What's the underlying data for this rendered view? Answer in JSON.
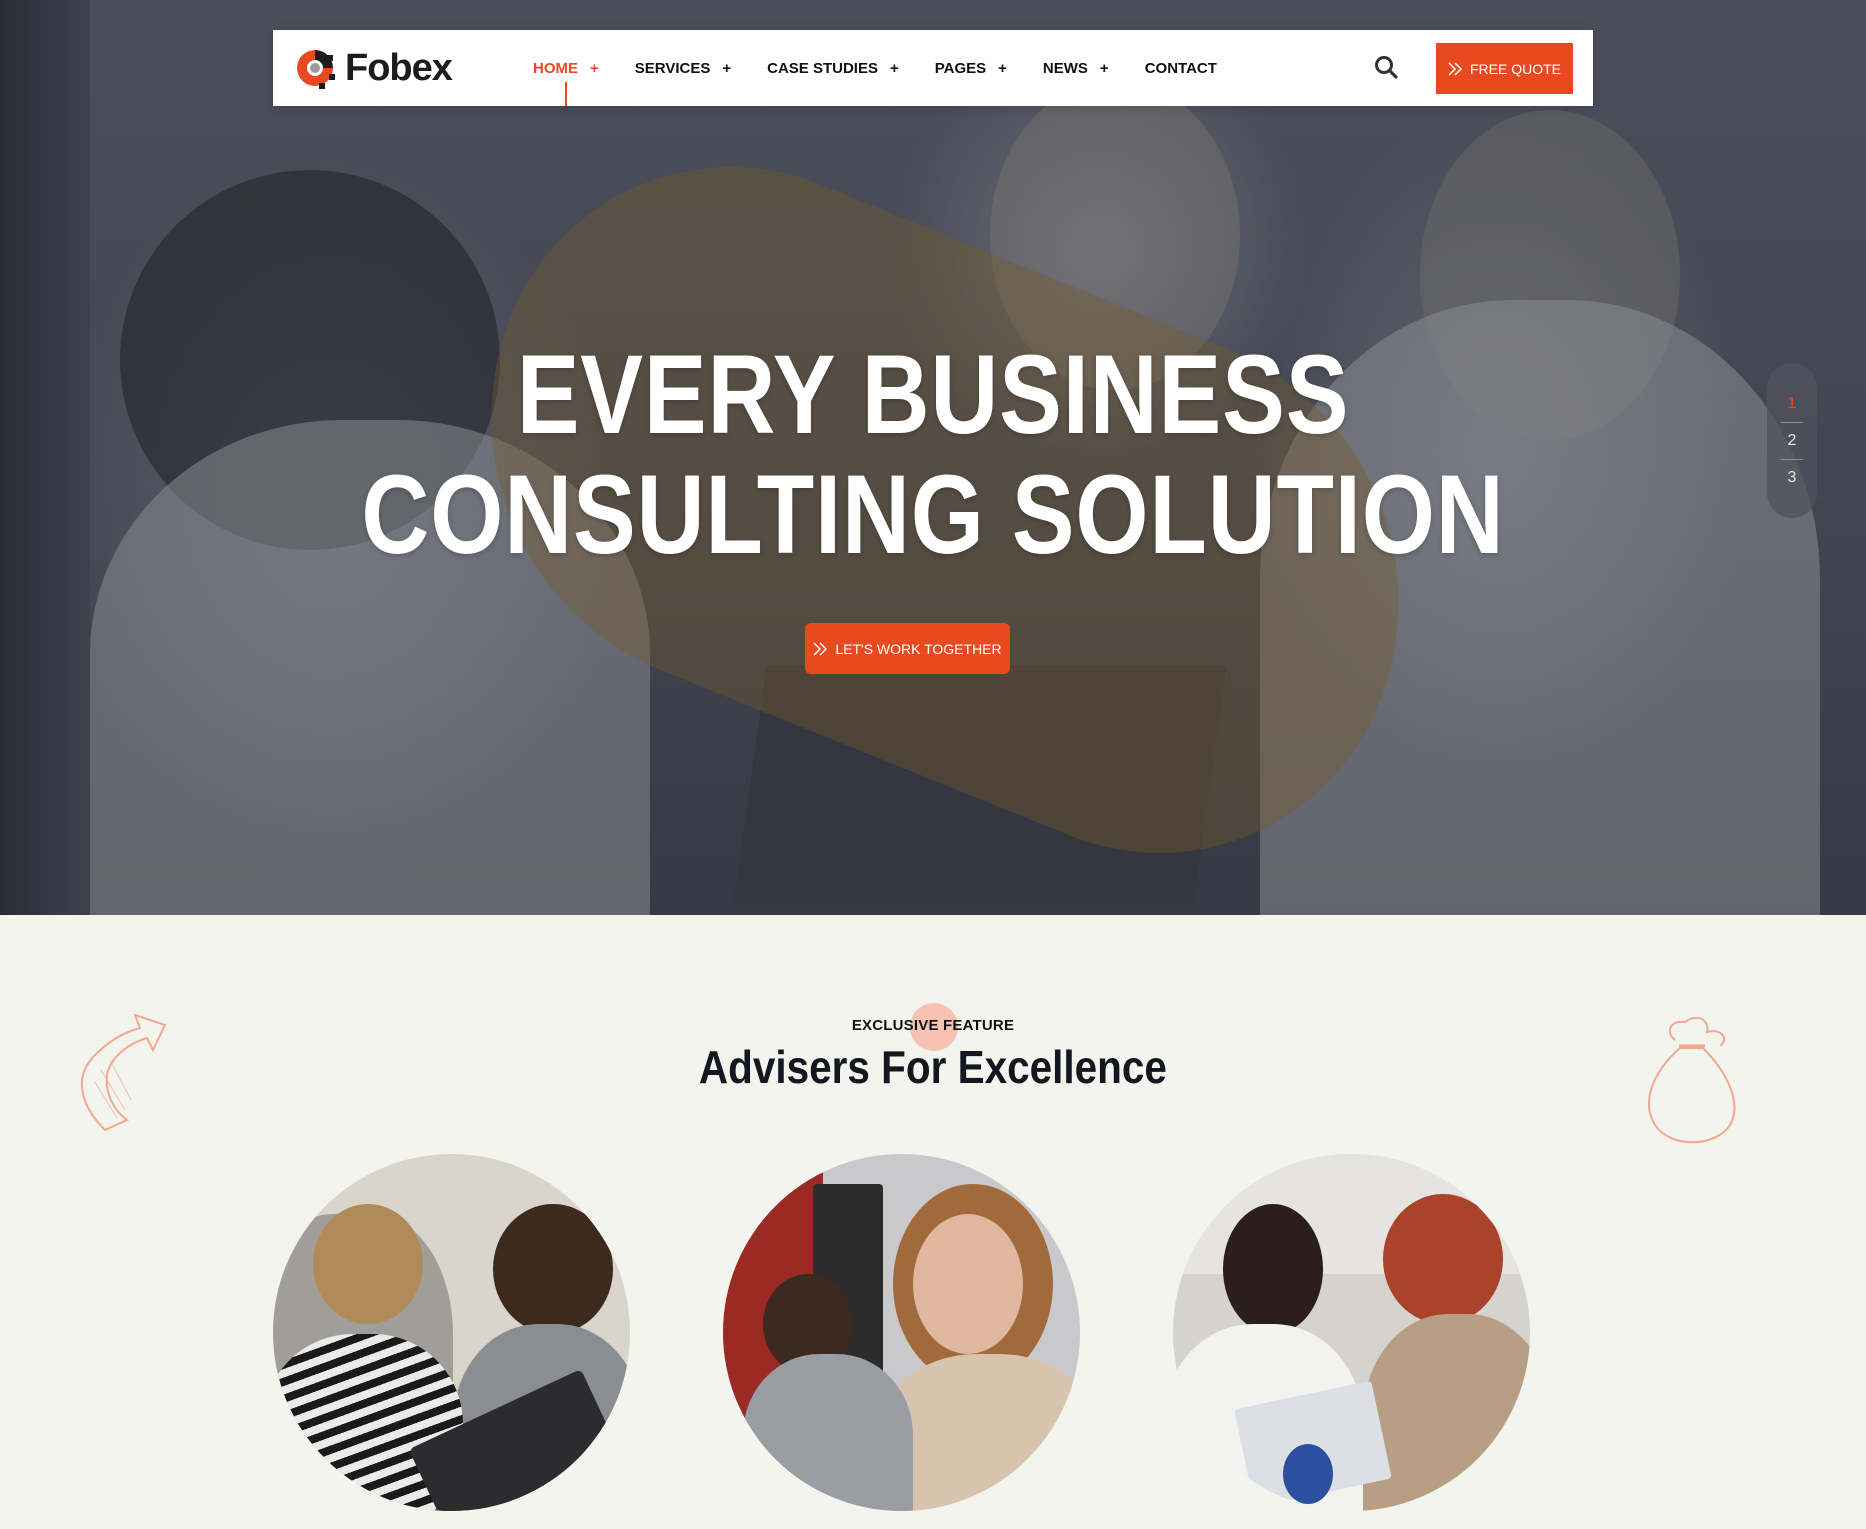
{
  "brand": {
    "name": "Fobex",
    "accent": "#e9491f"
  },
  "nav": {
    "items": [
      {
        "label": "HOME",
        "has_submenu": true,
        "active": true
      },
      {
        "label": "SERVICES",
        "has_submenu": true,
        "active": false
      },
      {
        "label": "CASE STUDIES",
        "has_submenu": true,
        "active": false
      },
      {
        "label": "PAGES",
        "has_submenu": true,
        "active": false
      },
      {
        "label": "NEWS",
        "has_submenu": true,
        "active": false
      },
      {
        "label": "CONTACT",
        "has_submenu": false,
        "active": false
      }
    ],
    "submenu_indicator": "+",
    "search_icon": "search-icon",
    "quote_button": "FREE QUOTE"
  },
  "hero": {
    "headline_line1": "EVERY BUSINESS",
    "headline_line2": "CONSULTING SOLUTION",
    "cta": "LET'S WORK TOGETHER",
    "slides": [
      "1",
      "2",
      "3"
    ],
    "active_slide": "1"
  },
  "feature": {
    "eyebrow": "EXCLUSIVE FEATURE",
    "title": "Advisers For Excellence"
  }
}
